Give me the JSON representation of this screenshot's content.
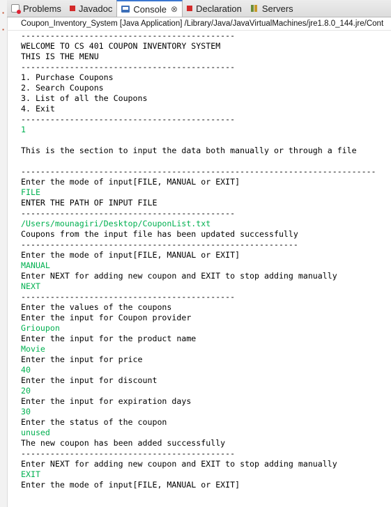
{
  "tabs": [
    {
      "label": "Problems",
      "icon": "problems-icon"
    },
    {
      "label": "Javadoc",
      "icon": "javadoc-icon"
    },
    {
      "label": "Console",
      "icon": "console-icon",
      "active": true
    },
    {
      "label": "Declaration",
      "icon": "declaration-icon"
    },
    {
      "label": "Servers",
      "icon": "servers-icon"
    }
  ],
  "close_symbol": "⊗",
  "launch_path": "Coupon_Inventory_System [Java Application] /Library/Java/JavaVirtualMachines/jre1.8.0_144.jre/Cont",
  "console_lines": [
    {
      "text": "--------------------------------------------",
      "kind": "out"
    },
    {
      "text": "WELCOME TO CS 401 COUPON INVENTORY SYSTEM",
      "kind": "out"
    },
    {
      "text": "THIS IS THE MENU",
      "kind": "out"
    },
    {
      "text": "--------------------------------------------",
      "kind": "out"
    },
    {
      "text": "1. Purchase Coupons",
      "kind": "out"
    },
    {
      "text": "2. Search Coupons",
      "kind": "out"
    },
    {
      "text": "3. List of all the Coupons",
      "kind": "out"
    },
    {
      "text": "4. Exit",
      "kind": "out"
    },
    {
      "text": "--------------------------------------------",
      "kind": "out"
    },
    {
      "text": "1",
      "kind": "in"
    },
    {
      "text": "",
      "kind": "out"
    },
    {
      "text": "This is the section to input the data both manually or through a file",
      "kind": "out"
    },
    {
      "text": "",
      "kind": "out"
    },
    {
      "text": "-------------------------------------------------------------------------",
      "kind": "out"
    },
    {
      "text": "Enter the mode of input[FILE, MANUAL or EXIT]",
      "kind": "out"
    },
    {
      "text": "FILE",
      "kind": "in"
    },
    {
      "text": "ENTER THE PATH OF INPUT FILE",
      "kind": "out"
    },
    {
      "text": "--------------------------------------------",
      "kind": "out"
    },
    {
      "text": "/Users/mounagiri/Desktop/CouponList.txt",
      "kind": "in"
    },
    {
      "text": "Coupons from the input file has been updated successfully",
      "kind": "out"
    },
    {
      "text": "---------------------------------------------------------",
      "kind": "out"
    },
    {
      "text": "Enter the mode of input[FILE, MANUAL or EXIT]",
      "kind": "out"
    },
    {
      "text": "MANUAL",
      "kind": "in"
    },
    {
      "text": "Enter NEXT for adding new coupon and EXIT to stop adding manually",
      "kind": "out"
    },
    {
      "text": "NEXT",
      "kind": "in"
    },
    {
      "text": "--------------------------------------------",
      "kind": "out"
    },
    {
      "text": "Enter the values of the coupons",
      "kind": "out"
    },
    {
      "text": "Enter the input for Coupon provider",
      "kind": "out"
    },
    {
      "text": "Grioupon",
      "kind": "in"
    },
    {
      "text": "Enter the input for the product name",
      "kind": "out"
    },
    {
      "text": "Movie",
      "kind": "in"
    },
    {
      "text": "Enter the input for price",
      "kind": "out"
    },
    {
      "text": "40",
      "kind": "in"
    },
    {
      "text": "Enter the input for discount",
      "kind": "out"
    },
    {
      "text": "20",
      "kind": "in"
    },
    {
      "text": "Enter the input for expiration days",
      "kind": "out"
    },
    {
      "text": "30",
      "kind": "in"
    },
    {
      "text": "Enter the status of the coupon",
      "kind": "out"
    },
    {
      "text": "unused",
      "kind": "in"
    },
    {
      "text": "The new coupon has been added successfully",
      "kind": "out"
    },
    {
      "text": "--------------------------------------------",
      "kind": "out"
    },
    {
      "text": "Enter NEXT for adding new coupon and EXIT to stop adding manually",
      "kind": "out"
    },
    {
      "text": "EXIT",
      "kind": "in"
    },
    {
      "text": "Enter the mode of input[FILE, MANUAL or EXIT]",
      "kind": "out",
      "caret": true
    }
  ],
  "colors": {
    "stdout": "#000000",
    "stdin": "#00b050",
    "active_tab_accent": "#3a76d0"
  }
}
